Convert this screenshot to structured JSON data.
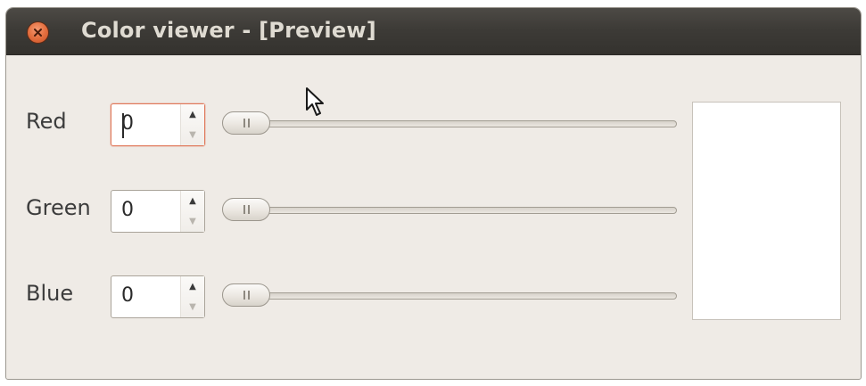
{
  "window": {
    "title": "Color viewer - [Preview]",
    "close_icon": "close-icon"
  },
  "rows": [
    {
      "label": "Red",
      "value": "0",
      "slider_fraction": 0.0,
      "focused": true
    },
    {
      "label": "Green",
      "value": "0",
      "slider_fraction": 0.0,
      "focused": false
    },
    {
      "label": "Blue",
      "value": "0",
      "slider_fraction": 0.0,
      "focused": false
    }
  ],
  "spin_icons": {
    "up": "▲",
    "down": "▼"
  },
  "preview": {
    "color": "#ffffff"
  },
  "colors": {
    "titlebar": "#3d3b37",
    "close_button": "#e46f3f",
    "window_bg": "#efebe6",
    "focus_border": "#e0785a"
  }
}
